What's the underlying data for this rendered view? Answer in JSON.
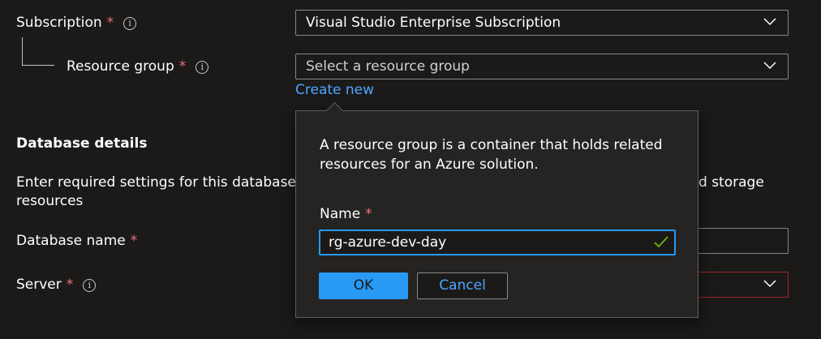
{
  "form": {
    "subscription": {
      "label": "Subscription",
      "required_mark": "*",
      "value": "Visual Studio Enterprise Subscription"
    },
    "resource_group": {
      "label": "Resource group",
      "required_mark": "*",
      "placeholder": "Select a resource group",
      "create_new_link": "Create new"
    },
    "database_details": {
      "heading": "Database details",
      "description_line1": "Enter required settings for this database, inc",
      "description_line1_tail": "d storage",
      "description_line2": "resources"
    },
    "database_name": {
      "label": "Database name",
      "required_mark": "*"
    },
    "server": {
      "label": "Server",
      "required_mark": "*"
    }
  },
  "callout": {
    "description": "A resource group is a container that holds related resources for an Azure solution.",
    "name_label": "Name",
    "name_required_mark": "*",
    "name_value": "rg-azure-dev-day",
    "ok_label": "OK",
    "cancel_label": "Cancel"
  },
  "icons": {
    "info": "info-icon",
    "dropdown": "chevron-down-icon",
    "valid": "checkmark-icon"
  },
  "colors": {
    "background": "#1b1a19",
    "accent": "#2899f5",
    "link": "#4da6ff",
    "required": "#f1707b",
    "error_border": "#a4262c",
    "valid": "#6bb700"
  }
}
